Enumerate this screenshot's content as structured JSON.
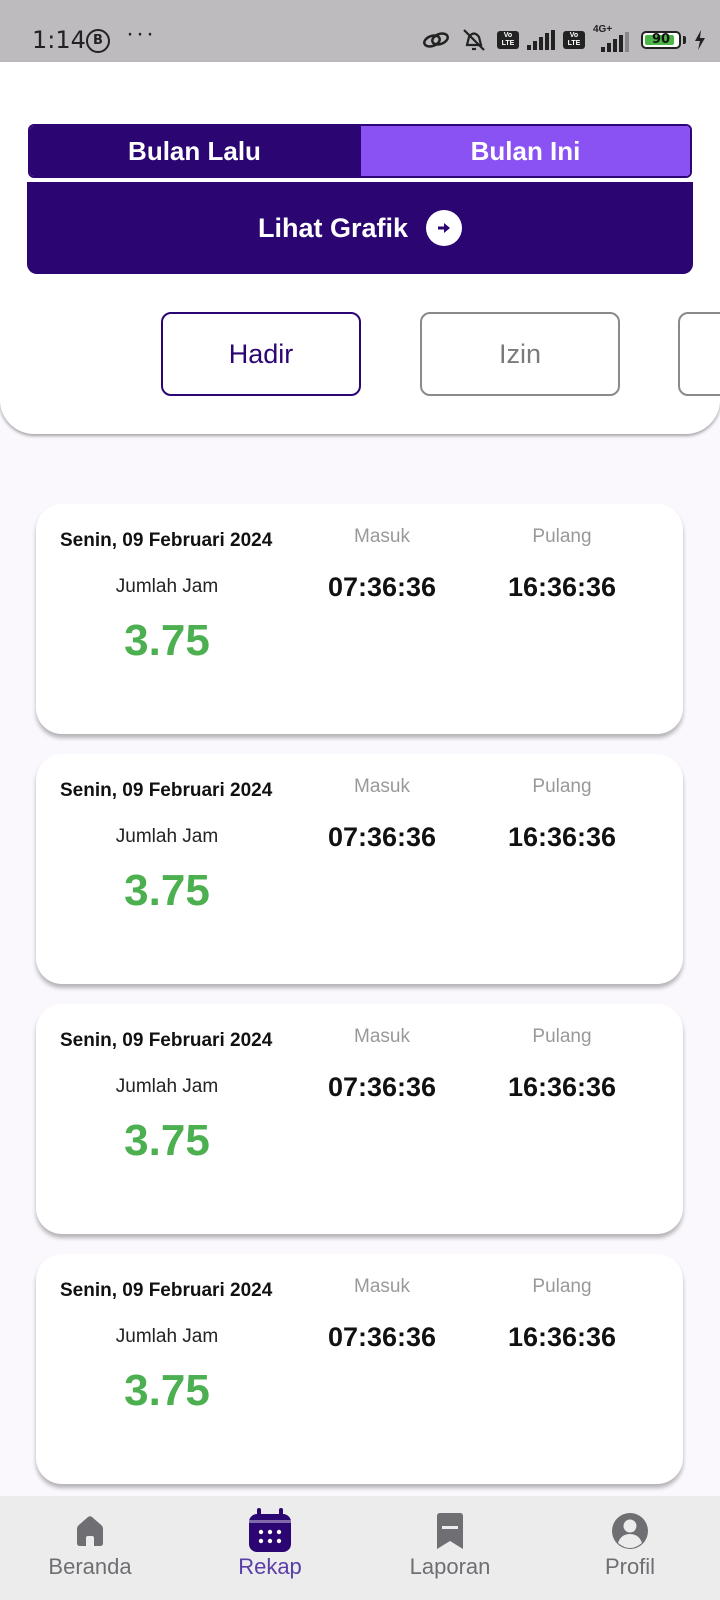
{
  "status_bar": {
    "time": "1:14",
    "badge": "B",
    "more": "···",
    "battery": "90",
    "battery_level": 0.9,
    "network": "4G+",
    "volte": "Vo LTE"
  },
  "header": {
    "month_tabs": {
      "previous": "Bulan Lalu",
      "current": "Bulan Ini"
    },
    "chart_button": "Lihat Grafik",
    "filters": [
      "Hadir",
      "Izin"
    ]
  },
  "records": [
    {
      "date": "Senin, 09 Februari 2024",
      "hours_label": "Jumlah Jam",
      "hours": "3.75",
      "in_label": "Masuk",
      "in_time": "07:36:36",
      "out_label": "Pulang",
      "out_time": "16:36:36"
    },
    {
      "date": "Senin, 09 Februari 2024",
      "hours_label": "Jumlah Jam",
      "hours": "3.75",
      "in_label": "Masuk",
      "in_time": "07:36:36",
      "out_label": "Pulang",
      "out_time": "16:36:36"
    },
    {
      "date": "Senin, 09 Februari 2024",
      "hours_label": "Jumlah Jam",
      "hours": "3.75",
      "in_label": "Masuk",
      "in_time": "07:36:36",
      "out_label": "Pulang",
      "out_time": "16:36:36"
    },
    {
      "date": "Senin, 09 Februari 2024",
      "hours_label": "Jumlah Jam",
      "hours": "3.75",
      "in_label": "Masuk",
      "in_time": "07:36:36",
      "out_label": "Pulang",
      "out_time": "16:36:36"
    }
  ],
  "nav": [
    {
      "label": "Beranda",
      "icon": "home-icon",
      "active": false
    },
    {
      "label": "Rekap",
      "icon": "calendar-icon",
      "active": true
    },
    {
      "label": "Laporan",
      "icon": "bookmark-icon",
      "active": false
    },
    {
      "label": "Profil",
      "icon": "profile-icon",
      "active": false
    }
  ],
  "colors": {
    "primary": "#2b0571",
    "accent": "#8a52f3",
    "hours_green": "#4caf50",
    "active_nav": "#5a3ea7"
  }
}
